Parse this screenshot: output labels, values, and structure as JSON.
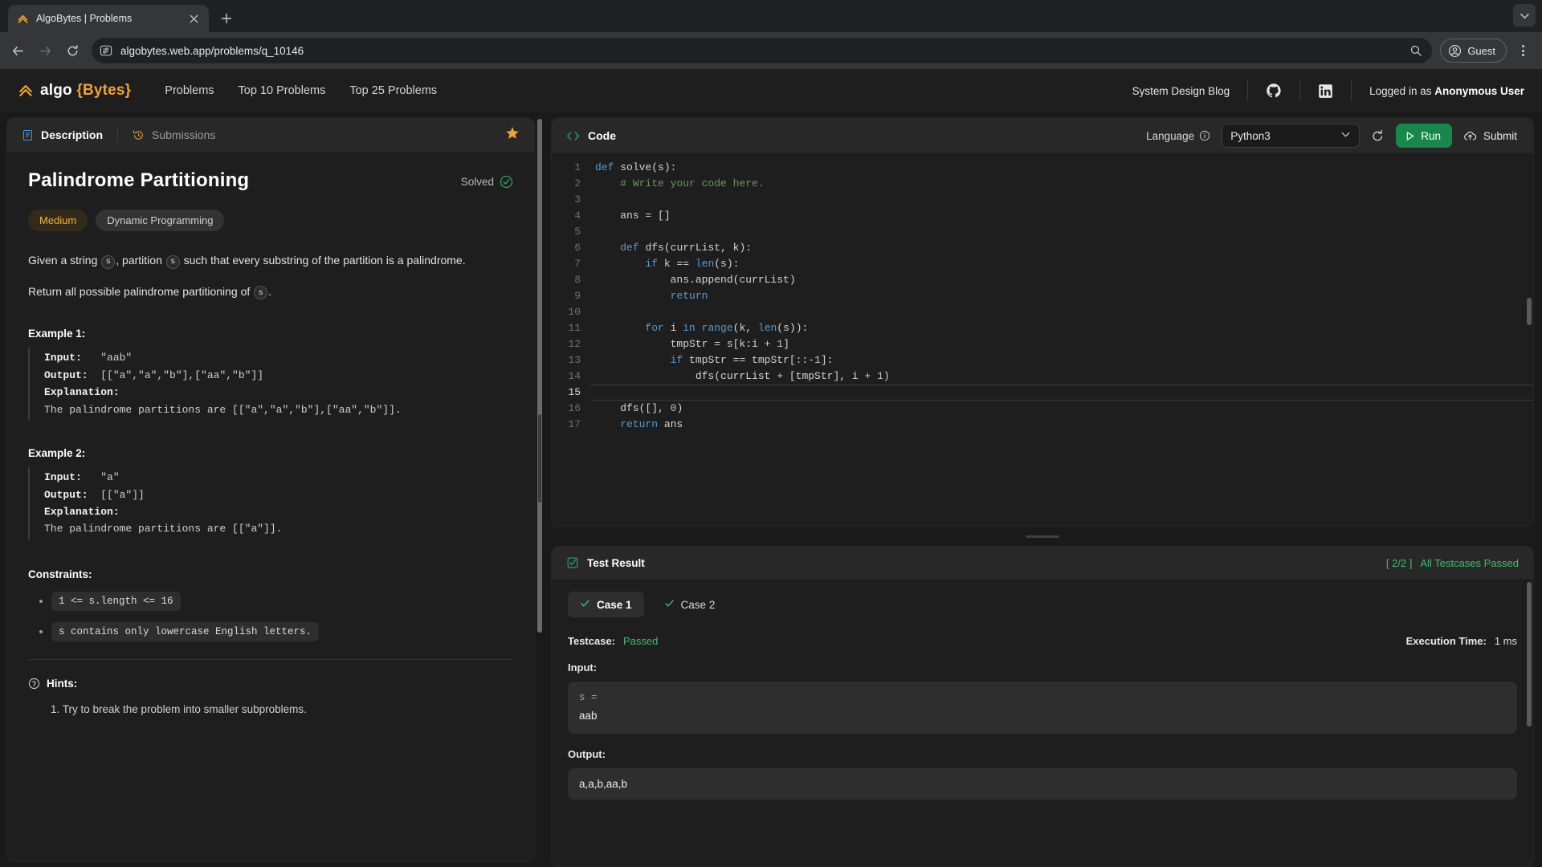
{
  "browser": {
    "tab": {
      "title": "AlgoBytes | Problems",
      "favicon_icon": "chevron-logo-icon",
      "close_icon": "close-icon"
    },
    "newtab_icon": "plus-icon",
    "chrome_menu_icon": "chevron-down-icon",
    "back_icon": "arrow-left-icon",
    "forward_icon": "arrow-right-icon",
    "reload_icon": "reload-icon",
    "site_info_icon": "site-settings-icon",
    "url": "algobytes.web.app/problems/q_10146",
    "search_icon": "search-icon",
    "profile_label": "Guest",
    "profile_icon": "account-circle-icon",
    "menu_icon": "kebab-menu-icon"
  },
  "navbar": {
    "logo_icon": "chevron-up-logo-icon",
    "brand_prefix": "algo ",
    "brand_accent": "{Bytes}",
    "links": [
      {
        "label": "Problems"
      },
      {
        "label": "Top 10 Problems"
      },
      {
        "label": "Top 25 Problems"
      }
    ],
    "blog_label": "System Design Blog",
    "github_icon": "github-icon",
    "linkedin_icon": "linkedin-icon",
    "logged_in_prefix": "Logged in as ",
    "logged_in_user": "Anonymous User"
  },
  "description_panel": {
    "tabs": [
      {
        "label": "Description",
        "icon": "document-icon",
        "active": true
      },
      {
        "label": "Submissions",
        "icon": "history-icon",
        "active": false
      }
    ],
    "favorite_icon": "star-icon",
    "title": "Palindrome Partitioning",
    "solved_label": "Solved",
    "solved_icon": "check-circle-icon",
    "difficulty": "Medium",
    "topic": "Dynamic Programming",
    "statement_1_a": "Given a string ",
    "statement_1_var1": "s",
    "statement_1_b": ", partition ",
    "statement_1_var2": "s",
    "statement_1_c": " such that every substring of the partition is a palindrome.",
    "statement_2_a": "Return all possible palindrome partitioning of ",
    "statement_2_var": "s",
    "statement_2_b": ".",
    "examples": [
      {
        "heading": "Example 1:",
        "input_label": "Input:",
        "input_value": "\"aab\"",
        "output_label": "Output:",
        "output_value": "[[\"a\",\"a\",\"b\"],[\"aa\",\"b\"]]",
        "explanation_label": "Explanation:",
        "explanation_value": "The palindrome partitions are [[\"a\",\"a\",\"b\"],[\"aa\",\"b\"]]."
      },
      {
        "heading": "Example 2:",
        "input_label": "Input:",
        "input_value": "\"a\"",
        "output_label": "Output:",
        "output_value": "[[\"a\"]]",
        "explanation_label": "Explanation:",
        "explanation_value": "The palindrome partitions are [[\"a\"]]."
      }
    ],
    "constraints_heading": "Constraints:",
    "constraints": [
      "1 <= s.length <= 16",
      "s contains only lowercase English letters."
    ],
    "hints_heading": "Hints:",
    "hints_icon": "question-circle-icon",
    "hints": [
      "1. Try to break the problem into smaller subproblems."
    ]
  },
  "code_panel": {
    "title": "Code",
    "title_icon": "angle-brackets-icon",
    "language_label": "Language",
    "info_icon": "info-icon",
    "language_value": "Python3",
    "dropdown_icon": "chevron-down-icon",
    "reset_icon": "reset-icon",
    "run_label": "Run",
    "run_icon": "play-icon",
    "run_color": "#17874a",
    "submit_label": "Submit",
    "submit_icon": "upload-cloud-icon",
    "lines": [
      {
        "n": "1",
        "segments": [
          {
            "t": "def ",
            "c": "kw"
          },
          {
            "t": "solve(s):",
            "c": ""
          }
        ]
      },
      {
        "n": "2",
        "segments": [
          {
            "t": "    # Write your code here.",
            "c": "cmt"
          }
        ]
      },
      {
        "n": "3",
        "segments": [
          {
            "t": "",
            "c": ""
          }
        ]
      },
      {
        "n": "4",
        "segments": [
          {
            "t": "    ans = []",
            "c": ""
          }
        ]
      },
      {
        "n": "5",
        "segments": [
          {
            "t": "",
            "c": ""
          }
        ]
      },
      {
        "n": "6",
        "segments": [
          {
            "t": "    ",
            "c": ""
          },
          {
            "t": "def ",
            "c": "kw"
          },
          {
            "t": "dfs(currList, k):",
            "c": ""
          }
        ]
      },
      {
        "n": "7",
        "segments": [
          {
            "t": "        ",
            "c": ""
          },
          {
            "t": "if",
            "c": "kw"
          },
          {
            "t": " k == ",
            "c": ""
          },
          {
            "t": "len",
            "c": "bi"
          },
          {
            "t": "(s):",
            "c": ""
          }
        ]
      },
      {
        "n": "8",
        "segments": [
          {
            "t": "            ans.append(currList)",
            "c": ""
          }
        ]
      },
      {
        "n": "9",
        "segments": [
          {
            "t": "            ",
            "c": ""
          },
          {
            "t": "return",
            "c": "kw"
          }
        ]
      },
      {
        "n": "10",
        "segments": [
          {
            "t": "",
            "c": ""
          }
        ]
      },
      {
        "n": "11",
        "segments": [
          {
            "t": "        ",
            "c": ""
          },
          {
            "t": "for",
            "c": "kw"
          },
          {
            "t": " i ",
            "c": ""
          },
          {
            "t": "in",
            "c": "kw"
          },
          {
            "t": " ",
            "c": ""
          },
          {
            "t": "range",
            "c": "bi"
          },
          {
            "t": "(k, ",
            "c": ""
          },
          {
            "t": "len",
            "c": "bi"
          },
          {
            "t": "(s)):",
            "c": ""
          }
        ]
      },
      {
        "n": "12",
        "segments": [
          {
            "t": "            tmpStr = s[k:i + ",
            "c": ""
          },
          {
            "t": "1",
            "c": "num"
          },
          {
            "t": "]",
            "c": ""
          }
        ]
      },
      {
        "n": "13",
        "segments": [
          {
            "t": "            ",
            "c": ""
          },
          {
            "t": "if",
            "c": "kw"
          },
          {
            "t": " tmpStr == tmpStr[::-",
            "c": ""
          },
          {
            "t": "1",
            "c": "num"
          },
          {
            "t": "]:",
            "c": ""
          }
        ]
      },
      {
        "n": "14",
        "segments": [
          {
            "t": "                dfs(currList + [tmpStr], i + ",
            "c": ""
          },
          {
            "t": "1",
            "c": "num"
          },
          {
            "t": ")",
            "c": ""
          }
        ]
      },
      {
        "n": "15",
        "segments": [
          {
            "t": "",
            "c": ""
          }
        ],
        "active": true
      },
      {
        "n": "16",
        "segments": [
          {
            "t": "    dfs([], ",
            "c": ""
          },
          {
            "t": "0",
            "c": "num"
          },
          {
            "t": ")",
            "c": ""
          }
        ]
      },
      {
        "n": "17",
        "segments": [
          {
            "t": "    ",
            "c": ""
          },
          {
            "t": "return",
            "c": "kw"
          },
          {
            "t": " ans",
            "c": ""
          }
        ]
      }
    ]
  },
  "test_panel": {
    "title": "Test Result",
    "title_icon": "checklist-icon",
    "count_badge": "[ 2/2 ]",
    "status_text": "All Testcases Passed",
    "status_color": "#3fbf72",
    "cases": [
      {
        "label": "Case 1",
        "icon": "check-icon",
        "active": true
      },
      {
        "label": "Case 2",
        "icon": "check-icon",
        "active": false
      }
    ],
    "testcase_label": "Testcase:",
    "testcase_value": "Passed",
    "exec_time_label": "Execution Time:",
    "exec_time_value": "1 ms",
    "input_label": "Input:",
    "input_key": "s =",
    "input_value": "aab",
    "output_label": "Output:",
    "output_value": "a,a,b,aa,b"
  }
}
